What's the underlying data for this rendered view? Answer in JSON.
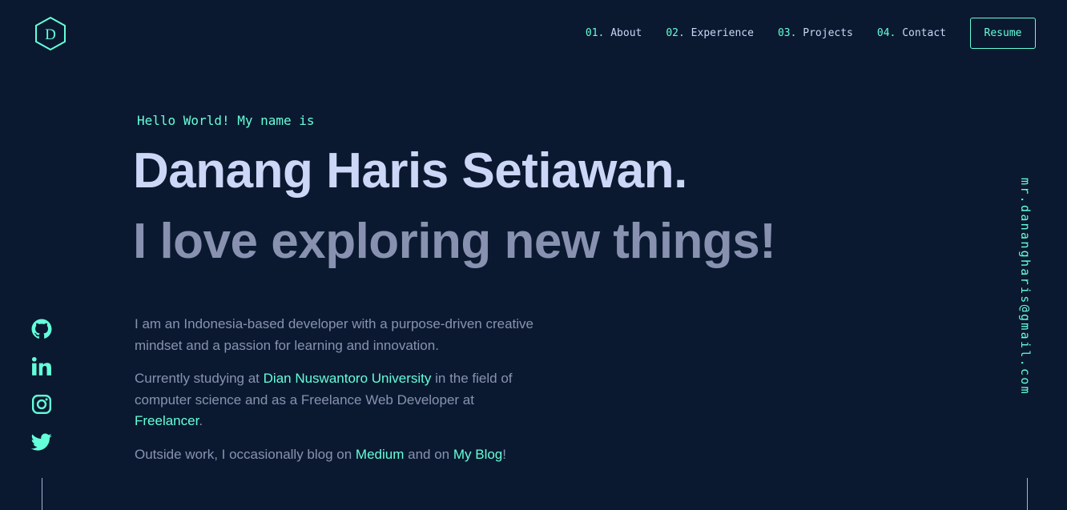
{
  "logo": {
    "letter": "D"
  },
  "nav": {
    "items": [
      {
        "number": "01.",
        "label": "About"
      },
      {
        "number": "02.",
        "label": "Experience"
      },
      {
        "number": "03.",
        "label": "Projects"
      },
      {
        "number": "04.",
        "label": "Contact"
      }
    ],
    "resume_label": "Resume"
  },
  "hero": {
    "greeting": "Hello World! My name is",
    "name": "Danang Haris Setiawan.",
    "tagline": "I love exploring new things!"
  },
  "bio": {
    "p1": "I am an Indonesia-based developer with a purpose-driven creative mindset and a passion for learning and innovation.",
    "p2_before": "Currently studying at ",
    "p2_link1": "Dian Nuswantoro University",
    "p2_middle": " in the field of computer science and as a Freelance Web Developer at ",
    "p2_link2": "Freelancer",
    "p2_after": ".",
    "p3_before": "Outside work, I occasionally blog on ",
    "p3_link1": "Medium",
    "p3_middle": " and on ",
    "p3_link2": "My Blog",
    "p3_after": "!"
  },
  "socials": [
    "github-icon",
    "linkedin-icon",
    "instagram-icon",
    "twitter-icon"
  ],
  "email": "mr.danangharis@gmail.com",
  "colors": {
    "background": "#0b1930",
    "accent": "#64ffda",
    "heading": "#ccd6f6",
    "text": "#8892b0"
  }
}
